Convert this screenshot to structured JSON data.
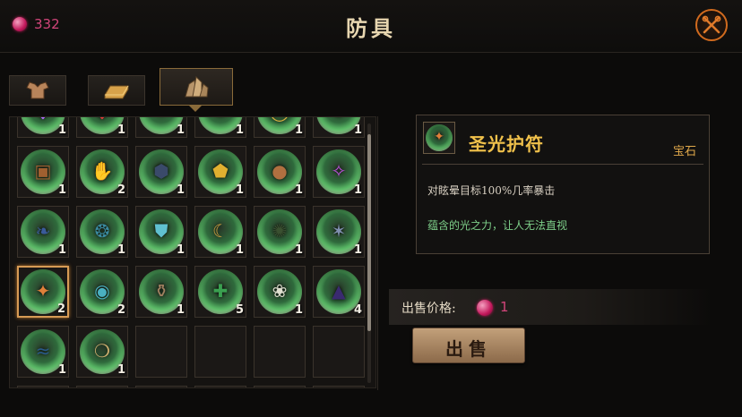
{
  "header": {
    "title": "防具",
    "currency": {
      "icon": "gem-icon",
      "value": "332",
      "color": "#d2457a"
    }
  },
  "tabs": [
    {
      "icon": "armor-icon",
      "active": false
    },
    {
      "icon": "gold-bar-icon",
      "active": false
    },
    {
      "icon": "gem-cluster-icon",
      "active": true
    }
  ],
  "inventory": [
    {
      "icon": "purple-amulet",
      "glyph": "◆",
      "color": "#b36bff",
      "count": "1"
    },
    {
      "icon": "red-gem",
      "glyph": "◆",
      "color": "#e23a3a",
      "count": "1"
    },
    {
      "icon": "dark-helm",
      "glyph": "✦",
      "color": "#4a5a7a",
      "count": "1"
    },
    {
      "icon": "orange-crest",
      "glyph": "✹",
      "color": "#e08a2a",
      "count": "1"
    },
    {
      "icon": "gold-ring",
      "glyph": "◯",
      "color": "#d8b040",
      "count": "1"
    },
    {
      "icon": "green-leaf",
      "glyph": "❦",
      "color": "#5ac070",
      "count": "1"
    },
    {
      "icon": "wooden-box",
      "glyph": "▣",
      "color": "#a06030",
      "count": "1"
    },
    {
      "icon": "blue-gauntlet",
      "glyph": "✋",
      "color": "#6a80c0",
      "count": "2"
    },
    {
      "icon": "dark-armor",
      "glyph": "⬢",
      "color": "#3a4a6a",
      "count": "1"
    },
    {
      "icon": "gold-pentagon",
      "glyph": "⬟",
      "color": "#e0b030",
      "count": "1"
    },
    {
      "icon": "bronze-orb",
      "glyph": "●",
      "color": "#b07040",
      "count": "1"
    },
    {
      "icon": "purple-rune",
      "glyph": "✧",
      "color": "#c050e0",
      "count": "1"
    },
    {
      "icon": "blue-wing",
      "glyph": "❧",
      "color": "#3a5a9a",
      "count": "1"
    },
    {
      "icon": "teal-horn",
      "glyph": "❂",
      "color": "#3a8aa0",
      "count": "1"
    },
    {
      "icon": "cyan-shield",
      "glyph": "⛊",
      "color": "#60c0d0",
      "count": "1"
    },
    {
      "icon": "gold-crescent",
      "glyph": "☾",
      "color": "#d0a040",
      "count": "1"
    },
    {
      "icon": "dark-beetle",
      "glyph": "✺",
      "color": "#3a5030",
      "count": "1"
    },
    {
      "icon": "silver-claw",
      "glyph": "✶",
      "color": "#8090b0",
      "count": "1"
    },
    {
      "icon": "holy-light-amulet",
      "glyph": "✦",
      "color": "#e0803a",
      "count": "2"
    },
    {
      "icon": "blue-eye",
      "glyph": "◉",
      "color": "#4ab0c0",
      "count": "2"
    },
    {
      "icon": "clay-vase",
      "glyph": "⚱",
      "color": "#a08060",
      "count": "1"
    },
    {
      "icon": "green-cross",
      "glyph": "✚",
      "color": "#3aa050",
      "count": "5"
    },
    {
      "icon": "white-feather",
      "glyph": "❀",
      "color": "#e0e0d0",
      "count": "1"
    },
    {
      "icon": "wizard-hat",
      "glyph": "▲",
      "color": "#3a2a70",
      "count": "4"
    },
    {
      "icon": "blue-wave",
      "glyph": "≈",
      "color": "#2a5a8a",
      "count": "1"
    },
    {
      "icon": "golden-tooth",
      "glyph": "❍",
      "color": "#d0b070",
      "count": "1"
    }
  ],
  "selected_item": {
    "name": "圣光护符",
    "type": "宝石",
    "effect": "对眩晕目标100%几率暴击",
    "description": "蕴含的光之力，让人无法直视",
    "glyph": "✦",
    "color": "#e0803a"
  },
  "sell": {
    "label": "出售价格:",
    "price": "1",
    "button_label": "出售"
  }
}
